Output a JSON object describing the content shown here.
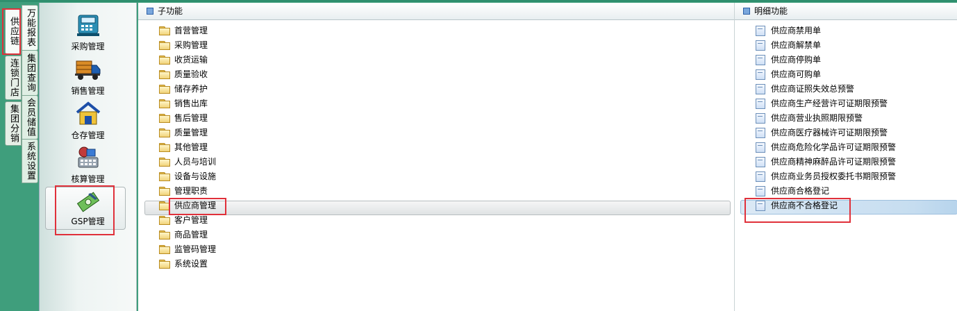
{
  "outer_tabs": [
    {
      "label": "供应链",
      "active": true
    },
    {
      "label": "连锁门店",
      "active": false
    },
    {
      "label": "集团分销",
      "active": false
    }
  ],
  "inner_tabs": [
    {
      "label": "万能报表",
      "active": true
    },
    {
      "label": "集团查询",
      "active": false
    },
    {
      "label": "会员储值",
      "active": false
    },
    {
      "label": "系统设置",
      "active": false
    }
  ],
  "nav": {
    "items": [
      {
        "label": "采购管理",
        "icon": "cash-register-icon"
      },
      {
        "label": "销售管理",
        "icon": "delivery-truck-icon"
      },
      {
        "label": "仓存管理",
        "icon": "warehouse-icon"
      },
      {
        "label": "核算管理",
        "icon": "accounting-calculator-icon"
      },
      {
        "label": "GSP管理",
        "icon": "gsp-money-icon",
        "selected": true
      }
    ]
  },
  "sub_panel": {
    "title": "子功能",
    "items": [
      "首营管理",
      "采购管理",
      "收货运输",
      "质量验收",
      "储存养护",
      "销售出库",
      "售后管理",
      "质量管理",
      "其他管理",
      "人员与培训",
      "设备与设施",
      "管理职责",
      "供应商管理",
      "客户管理",
      "商品管理",
      "监管码管理",
      "系统设置"
    ],
    "selected": "供应商管理"
  },
  "detail_panel": {
    "title": "明细功能",
    "items": [
      "供应商禁用单",
      "供应商解禁单",
      "供应商停购单",
      "供应商可购单",
      "供应商证照失效总预警",
      "供应商生产经营许可证期限预警",
      "供应商营业执照期限预警",
      "供应商医疗器械许可证期限预警",
      "供应商危险化学品许可证期限预警",
      "供应商精神麻醉品许可证期限预警",
      "供应商业务员授权委托书期限预警",
      "供应商合格登记",
      "供应商不合格登记"
    ],
    "selected": "供应商不合格登记"
  },
  "colors": {
    "background": "#3f9e7c",
    "highlight": "#e0303a"
  }
}
